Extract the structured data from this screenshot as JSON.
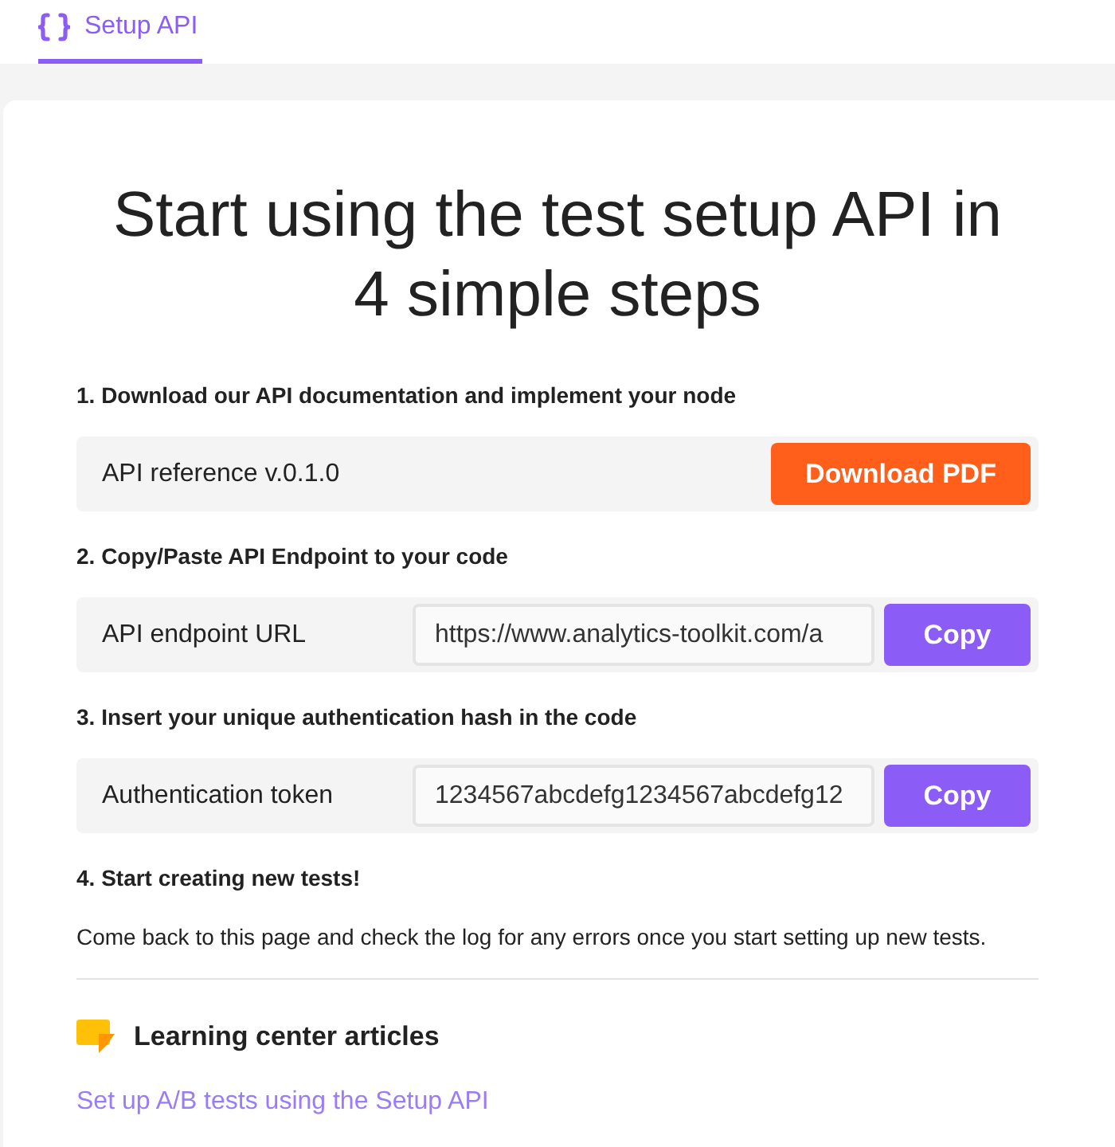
{
  "tabs": [
    {
      "label": "Setup API",
      "selected": true
    }
  ],
  "title": "Start using the test setup API in 4 simple steps",
  "steps": [
    {
      "heading": "1. Download our API documentation and implement your node",
      "kind": "download",
      "label": "API reference v.0.1.0",
      "button": "Download PDF"
    },
    {
      "heading": "2. Copy/Paste API Endpoint to your code",
      "kind": "copy",
      "label": "API endpoint URL",
      "value": "https://www.analytics-toolkit.com/a",
      "button": "Copy"
    },
    {
      "heading": "3. Insert your unique authentication hash in the code",
      "kind": "copy",
      "label": "Authentication token",
      "value": "1234567abcdefg1234567abcdefg12",
      "button": "Copy"
    },
    {
      "heading": "4. Start creating new tests!",
      "kind": "note",
      "text": "Come back to this page and check the log for any errors once you start setting up new tests."
    }
  ],
  "learning": {
    "title": "Learning center articles",
    "links": [
      "Set up A/B tests using the Setup API"
    ]
  }
}
